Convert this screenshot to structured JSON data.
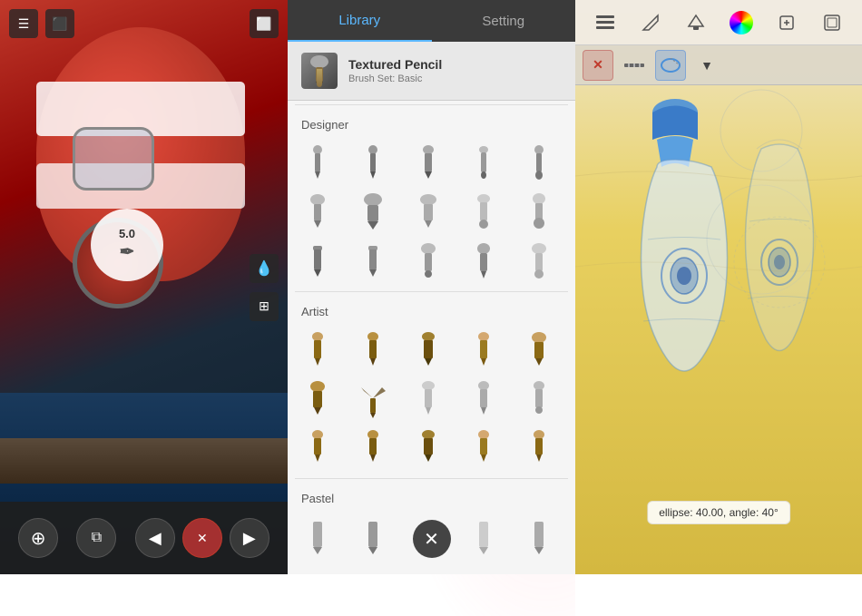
{
  "left_panel": {
    "size_value": "5.0",
    "top_left_icon1": "☰",
    "top_left_icon2": "⬜",
    "top_right_icon": "⬜",
    "bottom_buttons": [
      {
        "id": "add-layer",
        "icon": "⊕",
        "style": "dark"
      },
      {
        "id": "close",
        "icon": "✕",
        "style": "red"
      },
      {
        "id": "layers",
        "icon": "⧉",
        "style": "dark"
      },
      {
        "id": "prev",
        "icon": "◀",
        "style": "dark"
      },
      {
        "id": "next",
        "icon": "▶",
        "style": "dark"
      }
    ],
    "water_icon": "💧",
    "grid_icon": "⊞"
  },
  "middle_panel": {
    "tabs": [
      {
        "label": "Library",
        "active": true
      },
      {
        "label": "Setting",
        "active": false
      }
    ],
    "selected_brush": {
      "name": "Textured Pencil",
      "set": "Brush Set: Basic"
    },
    "sections": [
      {
        "label": "Designer",
        "brushes": [
          {
            "shape": "pencil-thin",
            "color": "#888"
          },
          {
            "shape": "pencil-medium",
            "color": "#777"
          },
          {
            "shape": "pencil-dark",
            "color": "#666"
          },
          {
            "shape": "pencil-tip",
            "color": "#555"
          },
          {
            "shape": "pencil-round",
            "color": "#888"
          },
          {
            "shape": "brush-large",
            "color": "#aaa"
          },
          {
            "shape": "brush-xl",
            "color": "#999"
          },
          {
            "shape": "brush-tapered",
            "color": "#888"
          },
          {
            "shape": "brush-metal",
            "color": "#bbb"
          },
          {
            "shape": "brush-dome",
            "color": "#aaa"
          },
          {
            "shape": "pen-flat",
            "color": "#777"
          },
          {
            "shape": "pen-ink",
            "color": "#888"
          },
          {
            "shape": "pen-round",
            "color": "#aaa"
          },
          {
            "shape": "pen-bullet",
            "color": "#999"
          },
          {
            "shape": "pen-dome2",
            "color": "#bbb"
          }
        ]
      },
      {
        "label": "Artist",
        "brushes": [
          {
            "shape": "artist-1",
            "color": "#8B6914"
          },
          {
            "shape": "artist-2",
            "color": "#7a5c10"
          },
          {
            "shape": "artist-3",
            "color": "#6b4f0e"
          },
          {
            "shape": "artist-4",
            "color": "#9a7a20"
          },
          {
            "shape": "artist-5",
            "color": "#8B6914"
          },
          {
            "shape": "artist-6",
            "color": "#7a5c10"
          },
          {
            "shape": "artist-fan",
            "color": "#5a4010"
          },
          {
            "shape": "artist-8",
            "color": "#ccc"
          },
          {
            "shape": "artist-9",
            "color": "#bbb"
          },
          {
            "shape": "artist-10",
            "color": "#aaa"
          },
          {
            "shape": "artist-11",
            "color": "#8B6914"
          },
          {
            "shape": "artist-12",
            "color": "#7a5c10"
          },
          {
            "shape": "artist-13",
            "color": "#6b4f0e"
          },
          {
            "shape": "artist-14",
            "color": "#9a7a20"
          },
          {
            "shape": "artist-15",
            "color": "#8B6914"
          }
        ]
      },
      {
        "label": "Pastel",
        "brushes": [
          {
            "shape": "pastel-1",
            "color": "#999"
          },
          {
            "shape": "pastel-2",
            "color": "#888"
          },
          {
            "shape": "pastel-3",
            "color": "#aaa"
          },
          {
            "shape": "pastel-4",
            "color": "#bbb"
          },
          {
            "shape": "pastel-5",
            "color": "#999"
          }
        ]
      }
    ],
    "close_icon": "✕"
  },
  "right_panel": {
    "toolbar_icons": [
      {
        "id": "list-icon",
        "symbol": "≡"
      },
      {
        "id": "ruler-icon",
        "symbol": "⊿"
      },
      {
        "id": "stamp-icon",
        "symbol": "▲"
      },
      {
        "id": "color-icon",
        "symbol": "◉"
      },
      {
        "id": "layers-icon",
        "symbol": "⊕"
      },
      {
        "id": "frame-icon",
        "symbol": "⬜"
      }
    ],
    "second_toolbar": [
      {
        "id": "close-x",
        "symbol": "✕",
        "style": "x"
      },
      {
        "id": "ruler-tool",
        "symbol": "📏",
        "style": "normal"
      },
      {
        "id": "ellipse-tool",
        "symbol": "◎",
        "style": "active"
      },
      {
        "id": "more-tool",
        "symbol": "▼",
        "style": "normal"
      }
    ],
    "ellipse_info": "ellipse: 40.00, angle: 40°"
  }
}
